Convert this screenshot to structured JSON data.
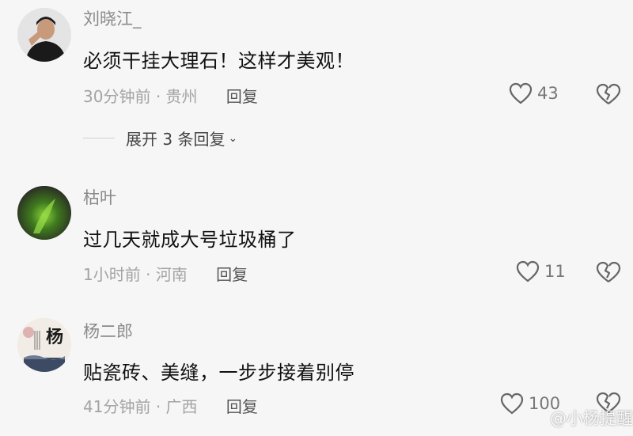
{
  "comments": [
    {
      "username": "刘晓江_",
      "content": "必须干挂大理石！这样才美观！",
      "time": "30分钟前",
      "location": "贵州",
      "reply_label": "回复",
      "likes": "43",
      "expand_label": "展开 3 条回复",
      "avatar_icon": "user-avatar-man"
    },
    {
      "username": "枯叶",
      "content": "过几天就成大号垃圾桶了",
      "time": "1小时前",
      "location": "河南",
      "reply_label": "回复",
      "likes": "11",
      "avatar_icon": "green-leaf-avatar"
    },
    {
      "username": "杨二郎",
      "content": "贴瓷砖、美缝，一步步接着别停",
      "time": "41分钟前",
      "location": "广西",
      "reply_label": "回复",
      "likes": "100",
      "avatar_icon": "calligraphy-avatar",
      "avatar_text": "杨"
    }
  ],
  "meta_separator": "·",
  "watermark": "@小杨提醒",
  "colors": {
    "background": "#f6f6f6",
    "secondary_text": "#a3a3a3",
    "username_text": "#8a8a8a"
  }
}
